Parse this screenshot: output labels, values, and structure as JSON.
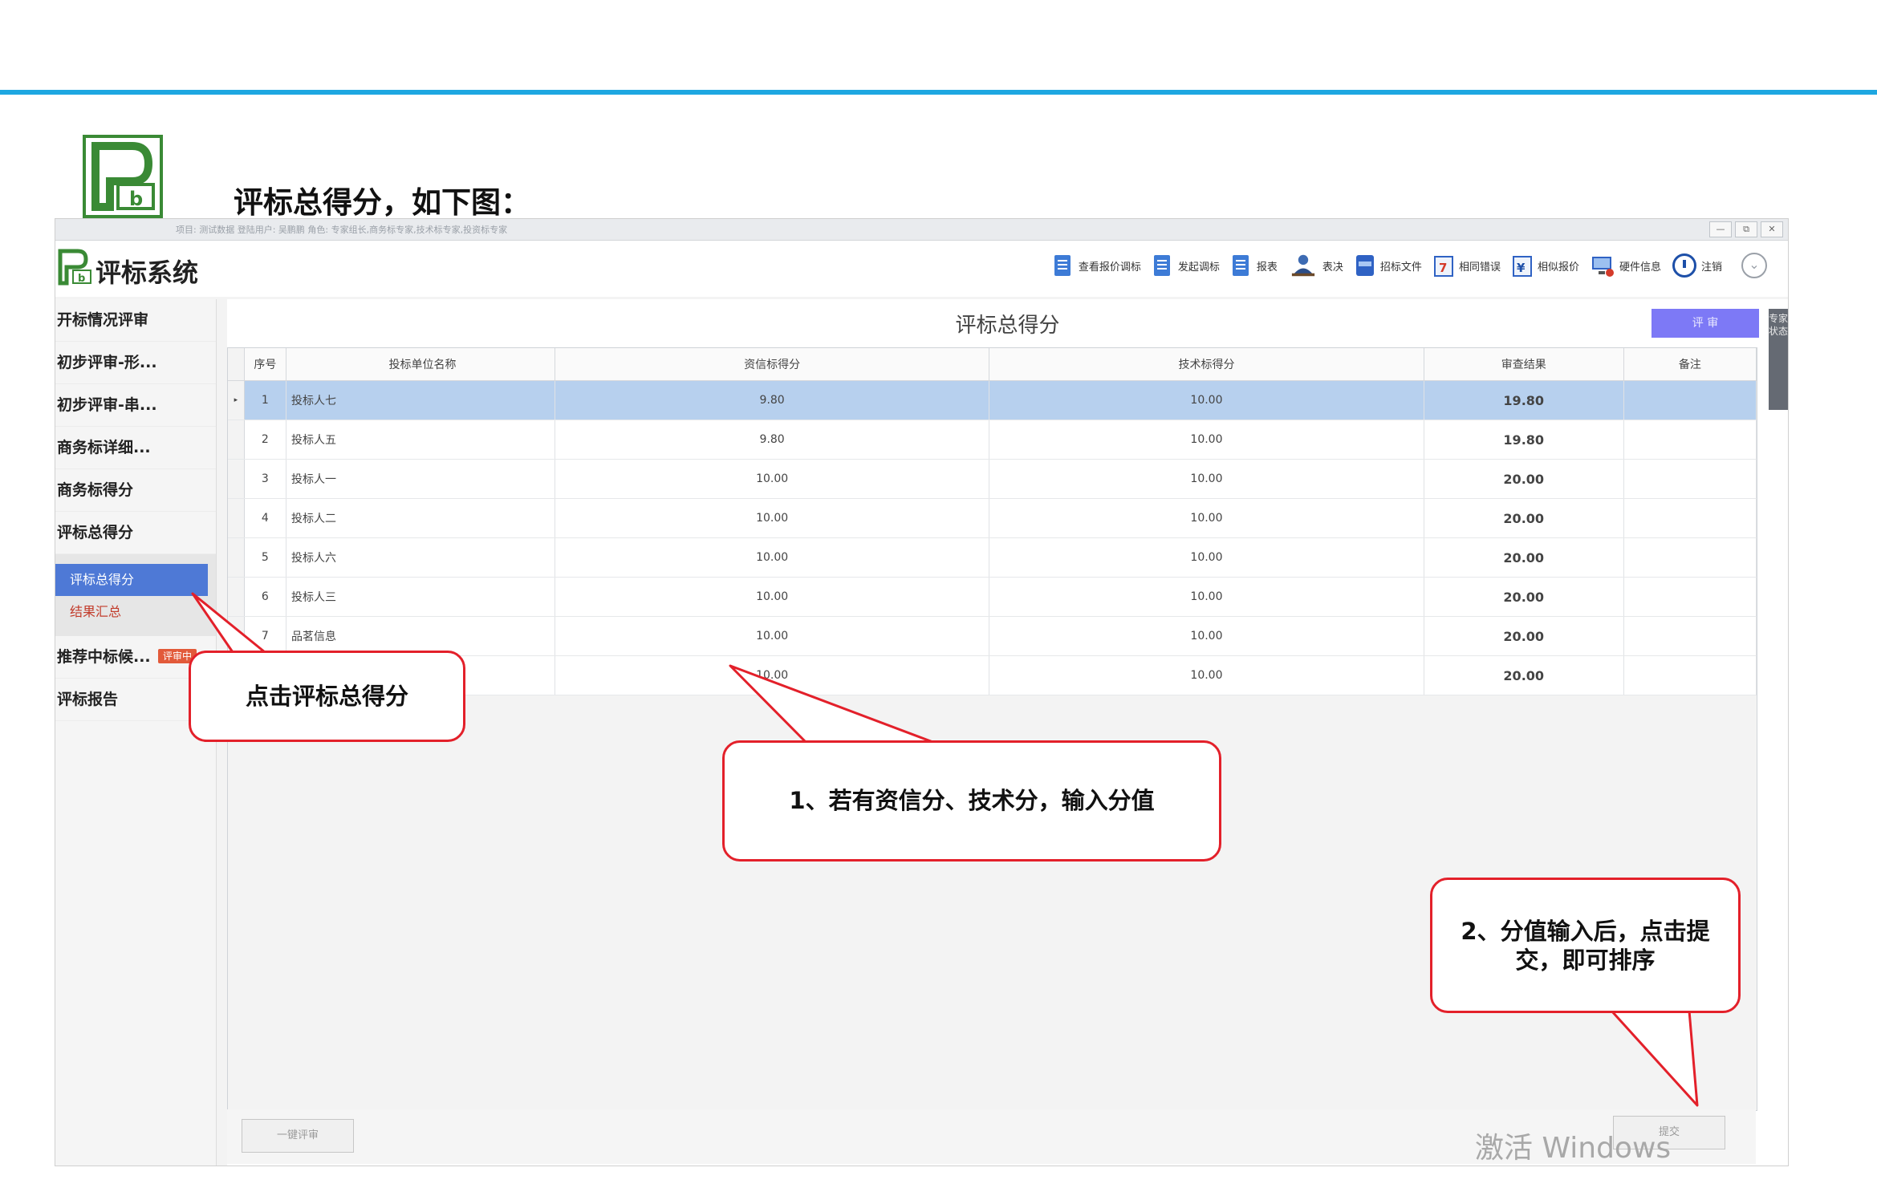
{
  "slide": {
    "title": "评标总得分，如下图："
  },
  "app": {
    "titlebar_text": "项目: 测试数据 登陆用户: 吴鹏鹏 角色: 专家组长,商务标专家,技术标专家,投资标专家",
    "window_controls": [
      "—",
      "⧉",
      "✕"
    ],
    "brand": "评标系统",
    "toolbar": [
      {
        "icon": "document-icon",
        "label": "查看报价调标"
      },
      {
        "icon": "document-icon",
        "label": "发起调标"
      },
      {
        "icon": "document-icon",
        "label": "报表"
      },
      {
        "icon": "user-vote-icon",
        "label": "表决"
      },
      {
        "icon": "book-icon",
        "label": "招标文件"
      },
      {
        "icon": "calendar-error-icon",
        "label": "相同错误"
      },
      {
        "icon": "price-icon",
        "label": "相似报价"
      },
      {
        "icon": "hardware-icon",
        "label": "硬件信息"
      },
      {
        "icon": "power-icon",
        "label": "注销"
      }
    ],
    "sidebar": {
      "items": [
        "开标情况评审",
        "初步评审-形...",
        "初步评审-串...",
        "商务标详细...",
        "商务标得分",
        "评标总得分"
      ],
      "sub_items": [
        "评标总得分",
        "结果汇总"
      ],
      "after_items": [
        {
          "label": "推荐中标候...",
          "badge": "评审中"
        },
        {
          "label": "评标报告"
        }
      ]
    },
    "main": {
      "title": "评标总得分",
      "eval_button": "评 审",
      "expert_tab": "专家状态",
      "columns": [
        "序号",
        "投标单位名称",
        "资信标得分",
        "技术标得分",
        "审查结果",
        "备注"
      ],
      "rows": [
        {
          "idx": "1",
          "name": "投标人七",
          "cred": "9.80",
          "tech": "10.00",
          "result": "19.80",
          "remark": ""
        },
        {
          "idx": "2",
          "name": "投标人五",
          "cred": "9.80",
          "tech": "10.00",
          "result": "19.80",
          "remark": ""
        },
        {
          "idx": "3",
          "name": "投标人一",
          "cred": "10.00",
          "tech": "10.00",
          "result": "20.00",
          "remark": ""
        },
        {
          "idx": "4",
          "name": "投标人二",
          "cred": "10.00",
          "tech": "10.00",
          "result": "20.00",
          "remark": ""
        },
        {
          "idx": "5",
          "name": "投标人六",
          "cred": "10.00",
          "tech": "10.00",
          "result": "20.00",
          "remark": ""
        },
        {
          "idx": "6",
          "name": "投标人三",
          "cred": "10.00",
          "tech": "10.00",
          "result": "20.00",
          "remark": ""
        },
        {
          "idx": "7",
          "name": "品茗信息",
          "cred": "10.00",
          "tech": "10.00",
          "result": "20.00",
          "remark": ""
        },
        {
          "idx": "",
          "name": "",
          "cred": "10.00",
          "tech": "10.00",
          "result": "20.00",
          "remark": ""
        }
      ],
      "batch_button": "一键评审",
      "submit_button": "提交"
    }
  },
  "callouts": {
    "c1": "点击评标总得分",
    "c2": "1、若有资信分、技术分，输入分值",
    "c3": "2、分值输入后，点击提交，即可排序"
  },
  "watermark": "激活 Windows",
  "colors": {
    "accent_line": "#1ea7e1",
    "callout_border": "#e3202a",
    "selected_row": "#b7d0ee",
    "active_nav": "#4e79d6"
  }
}
